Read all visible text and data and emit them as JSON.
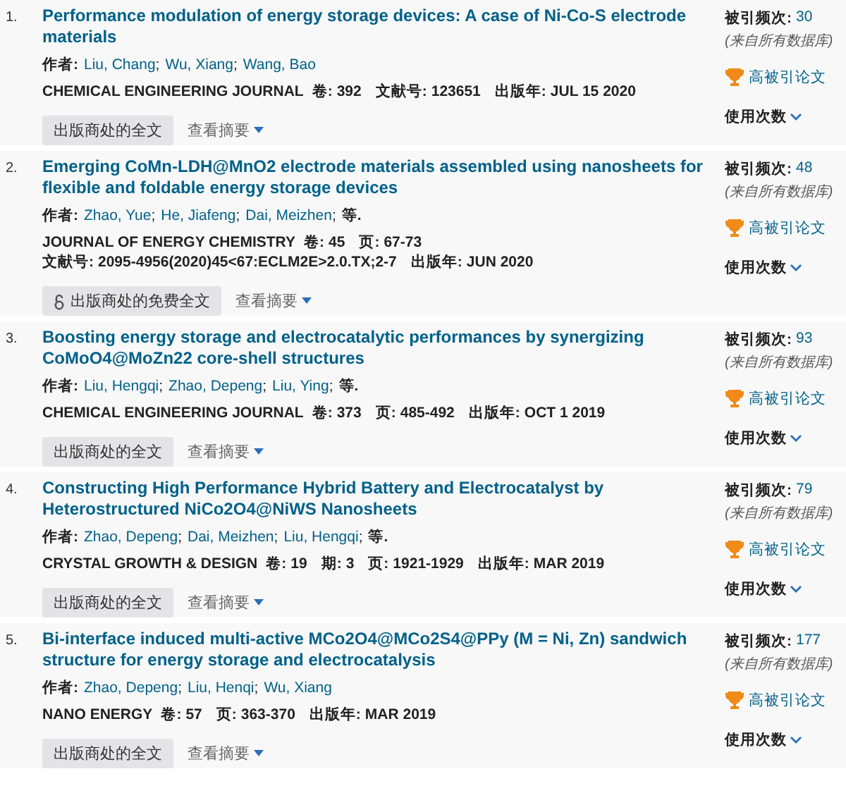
{
  "records": [
    {
      "number": "1.",
      "title": "Performance modulation of energy storage devices: A case of Ni-Co-S electrode materials",
      "authors_label": "作者:",
      "authors": [
        "Liu, Chang",
        "Wu, Xiang",
        "Wang, Bao"
      ],
      "separator": ";",
      "source": "CHEMICAL ENGINEERING JOURNAL",
      "meta": [
        {
          "label": "卷:",
          "value": "392"
        },
        {
          "label": "文献号:",
          "value": "123651"
        },
        {
          "label": "出版年:",
          "value": "JUL 15 2020"
        }
      ],
      "fulltext": {
        "kind": "publisher",
        "label": "出版商处的全文"
      },
      "abstract_link": "查看摘要",
      "citations_label": "被引频次:",
      "citations": "30",
      "citations_note": "(来自所有数据库)",
      "badge": "高被引论文",
      "usage": "使用次数"
    },
    {
      "number": "2.",
      "title": "Emerging CoMn-LDH@MnO2 electrode materials assembled using nanosheets for flexible and foldable energy storage devices",
      "authors_label": "作者:",
      "authors": [
        "Zhao, Yue",
        "He, Jiafeng",
        "Dai, Meizhen"
      ],
      "separator": ";",
      "et_al": "等.",
      "source": "JOURNAL OF ENERGY CHEMISTRY",
      "meta": [
        {
          "label": "卷:",
          "value": "45"
        },
        {
          "label": "页:",
          "value": "67-73"
        },
        {
          "label": "文献号:",
          "value": "2095-4956(2020)45<67:ECLM2E>2.0.TX;2-7"
        },
        {
          "label": "出版年:",
          "value": "JUN 2020"
        }
      ],
      "fulltext": {
        "kind": "open_access",
        "label": "出版商处的免费全文"
      },
      "abstract_link": "查看摘要",
      "citations_label": "被引频次:",
      "citations": "48",
      "citations_note": "(来自所有数据库)",
      "badge": "高被引论文",
      "usage": "使用次数"
    },
    {
      "number": "3.",
      "title": "Boosting energy storage and electrocatalytic performances by synergizing CoMoO4@MoZn22 core-shell structures",
      "authors_label": "作者:",
      "authors": [
        "Liu, Hengqi",
        "Zhao, Depeng",
        "Liu, Ying"
      ],
      "separator": ";",
      "et_al": "等.",
      "source": "CHEMICAL ENGINEERING JOURNAL",
      "meta": [
        {
          "label": "卷:",
          "value": "373"
        },
        {
          "label": "页:",
          "value": "485-492"
        },
        {
          "label": "出版年:",
          "value": "OCT 1 2019"
        }
      ],
      "fulltext": {
        "kind": "publisher",
        "label": "出版商处的全文"
      },
      "abstract_link": "查看摘要",
      "citations_label": "被引频次:",
      "citations": "93",
      "citations_note": "(来自所有数据库)",
      "badge": "高被引论文",
      "usage": "使用次数"
    },
    {
      "number": "4.",
      "title": "Constructing High Performance Hybrid Battery and Electrocatalyst by Heterostructured NiCo2O4@NiWS Nanosheets",
      "authors_label": "作者:",
      "authors": [
        "Zhao, Depeng",
        "Dai, Meizhen",
        "Liu, Hengqi"
      ],
      "separator": ";",
      "et_al": "等.",
      "source": "CRYSTAL GROWTH & DESIGN",
      "meta": [
        {
          "label": "卷:",
          "value": "19"
        },
        {
          "label": "期:",
          "value": "3"
        },
        {
          "label": "页:",
          "value": "1921-1929"
        },
        {
          "label": "出版年:",
          "value": "MAR 2019"
        }
      ],
      "fulltext": {
        "kind": "publisher",
        "label": "出版商处的全文"
      },
      "abstract_link": "查看摘要",
      "citations_label": "被引频次:",
      "citations": "79",
      "citations_note": "(来自所有数据库)",
      "badge": "高被引论文",
      "usage": "使用次数"
    },
    {
      "number": "5.",
      "title": "Bi-interface induced multi-active MCo2O4@MCo2S4@PPy (M = Ni, Zn) sandwich structure for energy storage and electrocatalysis",
      "authors_label": "作者:",
      "authors": [
        "Zhao, Depeng",
        "Liu, Henqi",
        "Wu, Xiang"
      ],
      "separator": ";",
      "source": "NANO ENERGY",
      "meta": [
        {
          "label": "卷:",
          "value": "57"
        },
        {
          "label": "页:",
          "value": "363-370"
        },
        {
          "label": "出版年:",
          "value": "MAR 2019"
        }
      ],
      "fulltext": {
        "kind": "publisher",
        "label": "出版商处的全文"
      },
      "abstract_link": "查看摘要",
      "citations_label": "被引频次:",
      "citations": "177",
      "citations_note": "(来自所有数据库)",
      "badge": "高被引论文",
      "usage": "使用次数"
    }
  ]
}
